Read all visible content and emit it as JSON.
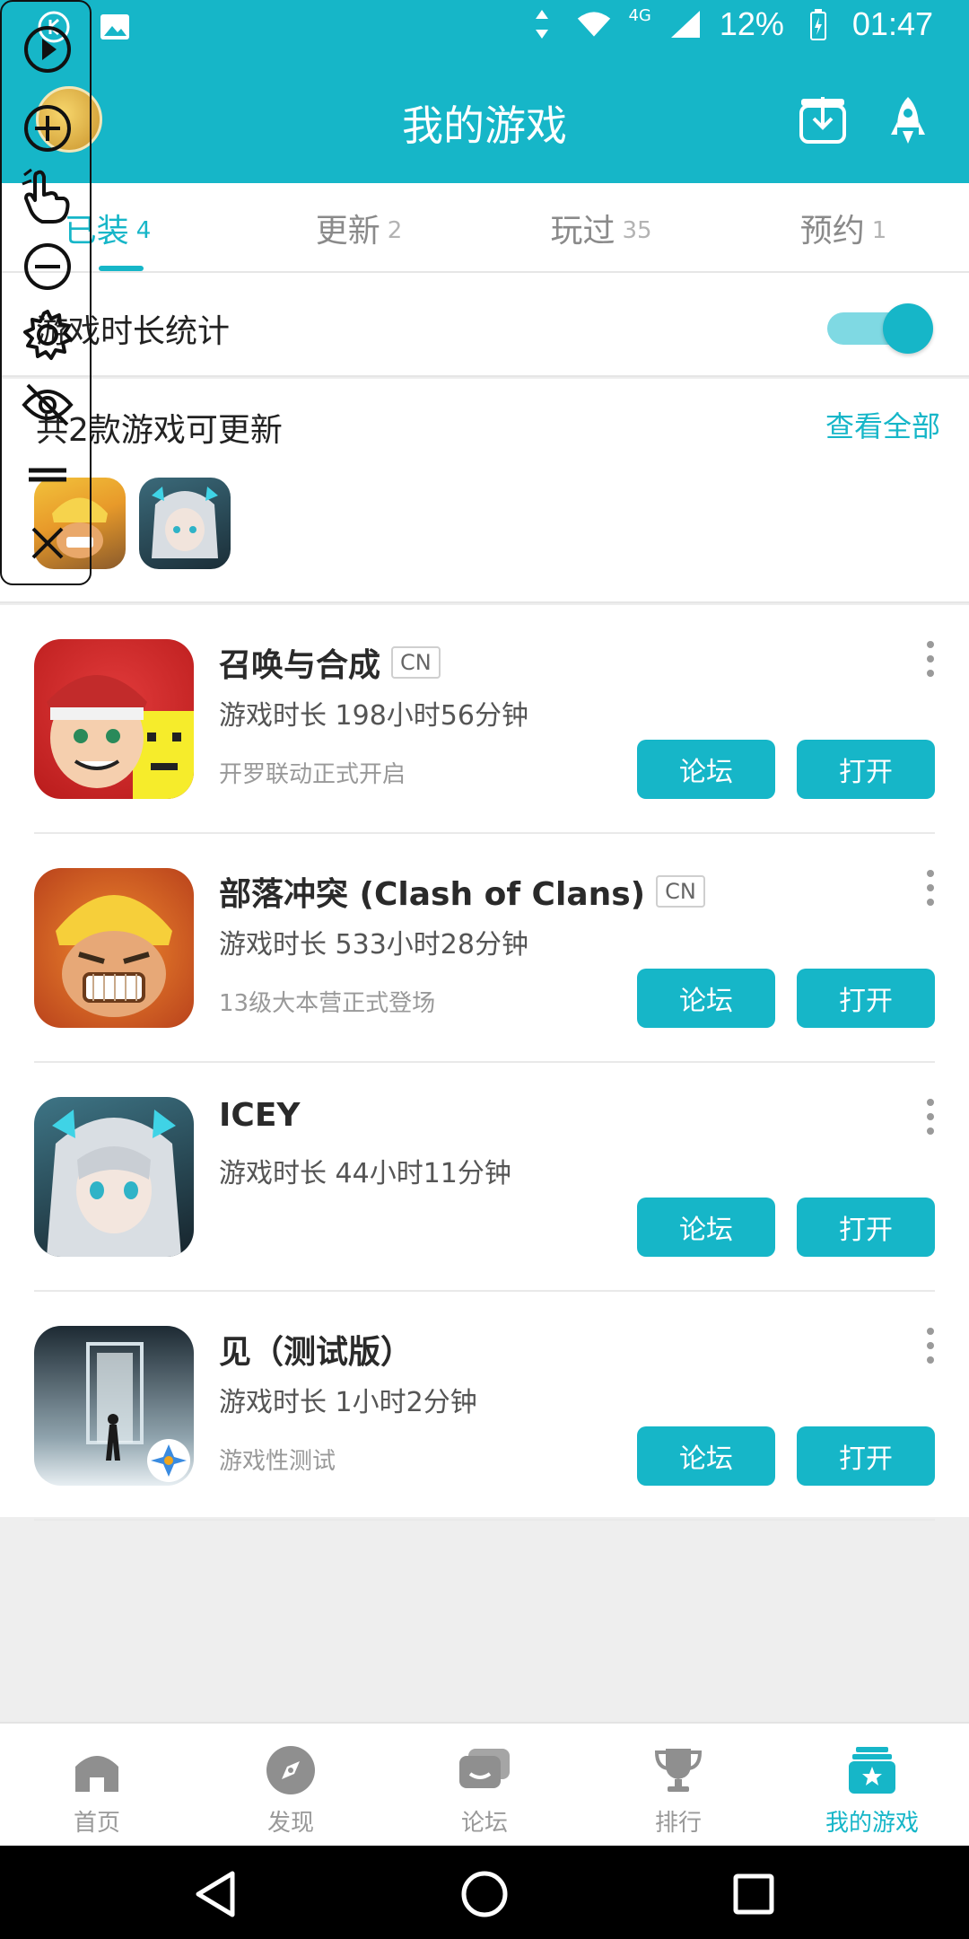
{
  "status_bar": {
    "network": "4G",
    "battery": "12%",
    "time": "01:47"
  },
  "header": {
    "title": "我的游戏"
  },
  "tabs": [
    {
      "label": "已装",
      "count": "4"
    },
    {
      "label": "更新",
      "count": "2"
    },
    {
      "label": "玩过",
      "count": "35"
    },
    {
      "label": "预约",
      "count": "1"
    }
  ],
  "stats": {
    "label": "游戏时长统计",
    "enabled": true
  },
  "updates": {
    "label": "共2款游戏可更新",
    "view_all": "查看全部"
  },
  "games": [
    {
      "name": "召唤与合成",
      "badge": "CN",
      "playtime": "游戏时长 198小时56分钟",
      "note": "开罗联动正式开启",
      "forum": "论坛",
      "open": "打开"
    },
    {
      "name": "部落冲突 (Clash of Clans)",
      "badge": "CN",
      "playtime": "游戏时长 533小时28分钟",
      "note": "13级大本营正式登场",
      "forum": "论坛",
      "open": "打开"
    },
    {
      "name": "ICEY",
      "badge": "",
      "playtime": "游戏时长 44小时11分钟",
      "note": "",
      "forum": "论坛",
      "open": "打开"
    },
    {
      "name": "见（测试版）",
      "badge": "",
      "playtime": "游戏时长 1小时2分钟",
      "note": "游戏性测试",
      "forum": "论坛",
      "open": "打开"
    }
  ],
  "bottom_nav": [
    {
      "label": "首页",
      "icon": "home-icon"
    },
    {
      "label": "发现",
      "icon": "compass-icon"
    },
    {
      "label": "论坛",
      "icon": "chat-icon"
    },
    {
      "label": "排行",
      "icon": "trophy-icon"
    },
    {
      "label": "我的游戏",
      "icon": "my-games-icon"
    }
  ],
  "colors": {
    "accent": "#16b6c8",
    "text": "#2a2a2a",
    "muted": "#999999"
  }
}
